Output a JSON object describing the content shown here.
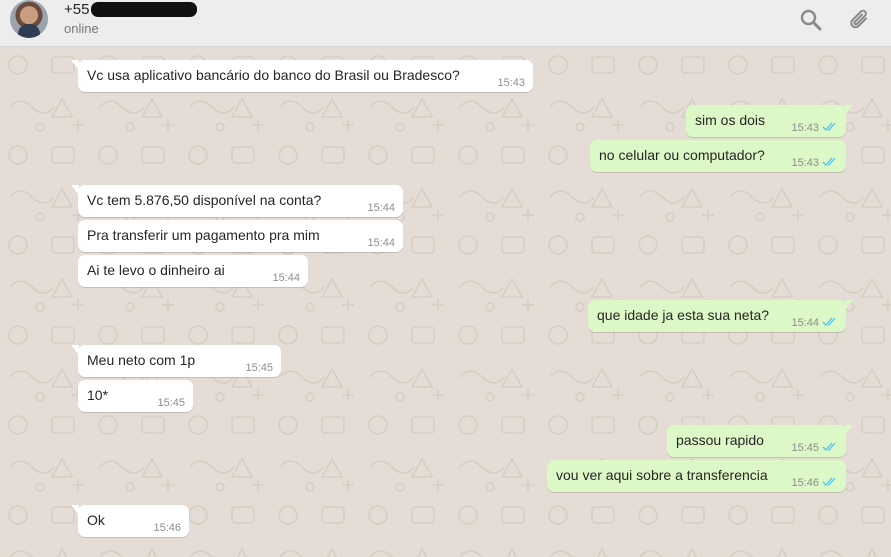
{
  "header": {
    "contact_name": "+55",
    "status": "online",
    "search_icon": "search-icon",
    "attach_icon": "paperclip-icon"
  },
  "colors": {
    "incoming_bubble": "#ffffff",
    "outgoing_bubble": "#dcf8c6",
    "read_ticks": "#4fc3f7",
    "chat_background": "#e5ddd5"
  },
  "messages": [
    {
      "text": "Vc usa aplicativo bancário do banco do Brasil  ou Bradesco?",
      "time": "15:43",
      "dir": "in"
    },
    {
      "text": "sim os dois",
      "time": "15:43",
      "dir": "out",
      "status": "read"
    },
    {
      "text": "no celular ou computador?",
      "time": "15:43",
      "dir": "out",
      "status": "read"
    },
    {
      "text": "Vc tem 5.876,50  disponível na conta?",
      "time": "15:44",
      "dir": "in"
    },
    {
      "text": "Pra transferir um pagamento pra mim",
      "time": "15:44",
      "dir": "in"
    },
    {
      "text": "Ai te levo o dinheiro ai",
      "time": "15:44",
      "dir": "in"
    },
    {
      "text": "que idade ja esta sua neta?",
      "time": "15:44",
      "dir": "out",
      "status": "read"
    },
    {
      "text": "Meu neto com 1p",
      "time": "15:45",
      "dir": "in"
    },
    {
      "text": "10*",
      "time": "15:45",
      "dir": "in"
    },
    {
      "text": "passou rapido",
      "time": "15:45",
      "dir": "out",
      "status": "read"
    },
    {
      "text": "vou ver aqui sobre a transferencia",
      "time": "15:46",
      "dir": "out",
      "status": "read"
    },
    {
      "text": "Ok",
      "time": "15:46",
      "dir": "in"
    }
  ]
}
